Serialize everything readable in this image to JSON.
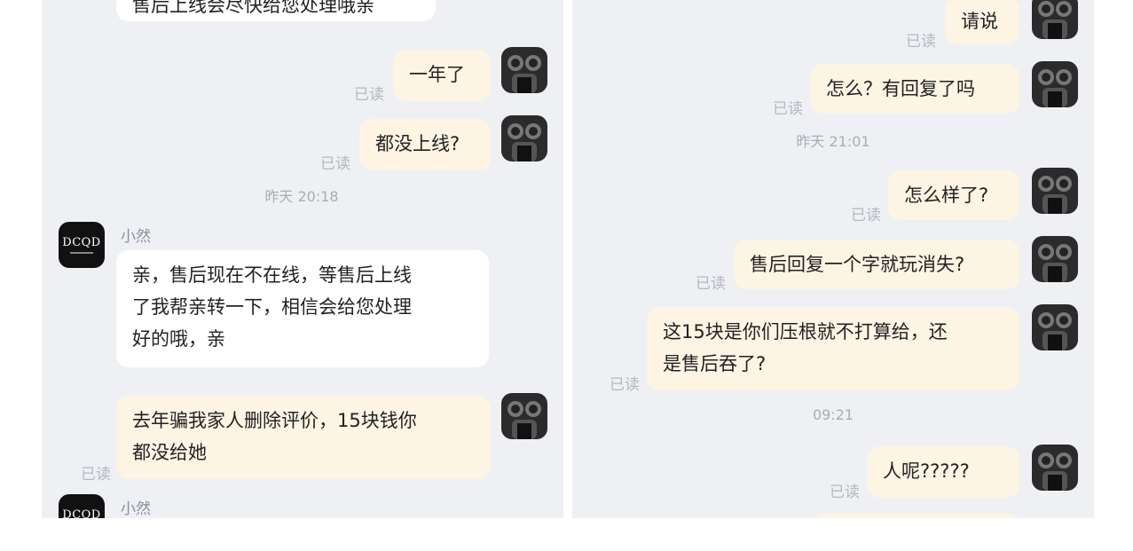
{
  "left": {
    "messages": [
      {
        "type": "in",
        "text": "售后上线会尽快给您处理哦亲"
      },
      {
        "type": "out",
        "text": "一年了",
        "status": "已读"
      },
      {
        "type": "out",
        "text": "都没上线?",
        "status": "已读"
      },
      {
        "type": "time",
        "text": "昨天 20:18"
      },
      {
        "type": "in",
        "sender": "小然",
        "text": "亲，售后现在不在线，等售后上线\n了我帮亲转一下，相信会给您处理\n好的哦，亲"
      },
      {
        "type": "out",
        "text": "去年骗我家人删除评价，15块钱你\n都没给她",
        "status": "已读"
      },
      {
        "type": "in",
        "sender": "小然",
        "text": ""
      }
    ]
  },
  "right": {
    "messages": [
      {
        "type": "out",
        "text": "请说",
        "status": "已读"
      },
      {
        "type": "out",
        "text": "怎么？有回复了吗",
        "status": "已读"
      },
      {
        "type": "time",
        "text": "昨天 21:01"
      },
      {
        "type": "out",
        "text": "怎么样了?",
        "status": "已读"
      },
      {
        "type": "out",
        "text": "售后回复一个字就玩消失?",
        "status": "已读"
      },
      {
        "type": "out",
        "text": "这15块是你们压根就不打算给，还\n是售后吞了?",
        "status": "已读"
      },
      {
        "type": "time",
        "text": "09:21"
      },
      {
        "type": "out",
        "text": "人呢?????",
        "status": "已读"
      }
    ]
  },
  "shop_avatar": {
    "logo": "DCQD",
    "icon": "shop-logo-icon"
  },
  "self_avatar": {
    "icon": "user-avatar-icon"
  },
  "colors": {
    "panel_bg": "#eef0f4",
    "outgoing_bubble": "#fdf4e4",
    "incoming_bubble": "#ffffff",
    "read_status": "#b4b8bf",
    "timestamp": "#a8adb5"
  }
}
